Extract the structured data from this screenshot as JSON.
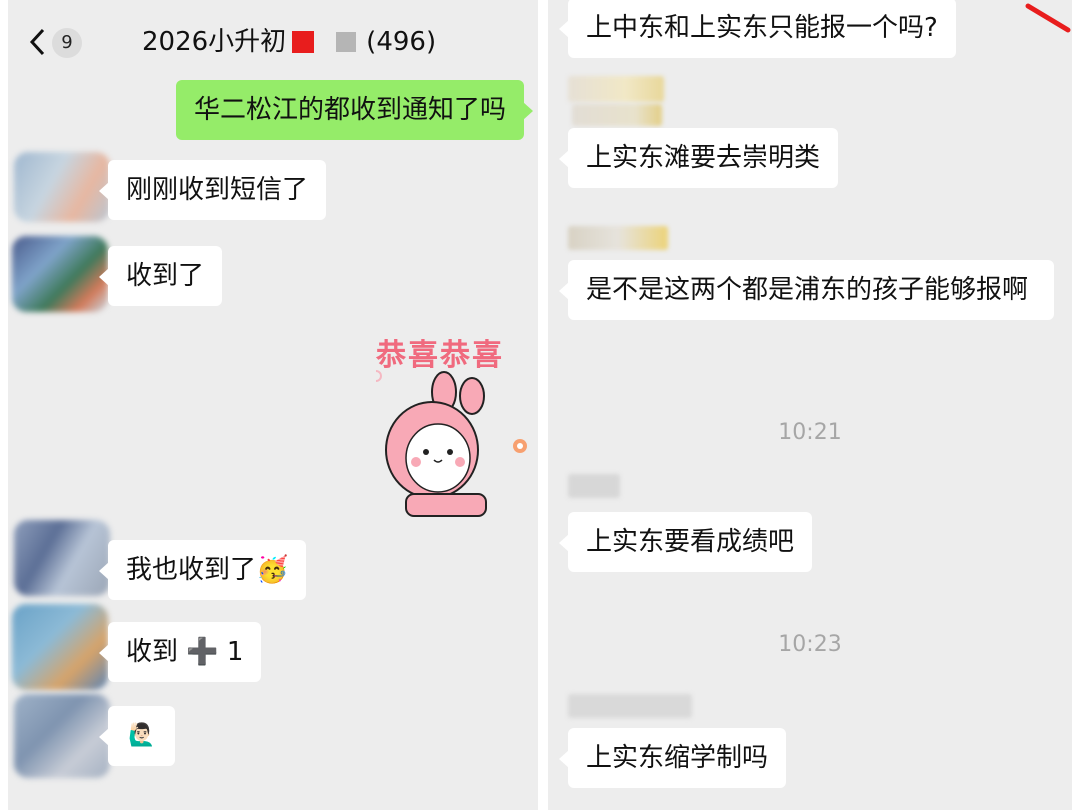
{
  "left": {
    "header": {
      "unread_badge": "9",
      "title_text": "2026小升初",
      "member_count": "(496)"
    },
    "messages": [
      {
        "text": "华二松江的都收到通知了吗",
        "type": "outgoing"
      },
      {
        "text": "刚刚收到短信了",
        "type": "incoming"
      },
      {
        "text": "收到了",
        "type": "incoming"
      },
      {
        "text": "我也收到了",
        "type": "incoming",
        "emoji": "🥳"
      },
      {
        "text": "收到 ➕ 1",
        "type": "incoming"
      },
      {
        "text": "",
        "type": "incoming",
        "emoji": "🙋🏻‍♂️"
      }
    ],
    "sticker_caption": "恭喜恭喜"
  },
  "right": {
    "messages": [
      {
        "text": "上中东和上实东只能报一个吗?"
      },
      {
        "text": "上实东滩要去崇明类"
      },
      {
        "text": "是不是这两个都是浦东的孩子能够报啊"
      },
      {
        "text": "上实东要看成绩吧"
      },
      {
        "text": "上实东缩学制吗"
      }
    ],
    "timestamps": [
      "10:21",
      "10:23"
    ]
  },
  "colors": {
    "outgoing_bubble": "#95ec69",
    "incoming_bubble": "#ffffff",
    "chat_background": "#ededed",
    "timestamp": "#a6a6a6",
    "red_annotation": "#e81d1d"
  }
}
